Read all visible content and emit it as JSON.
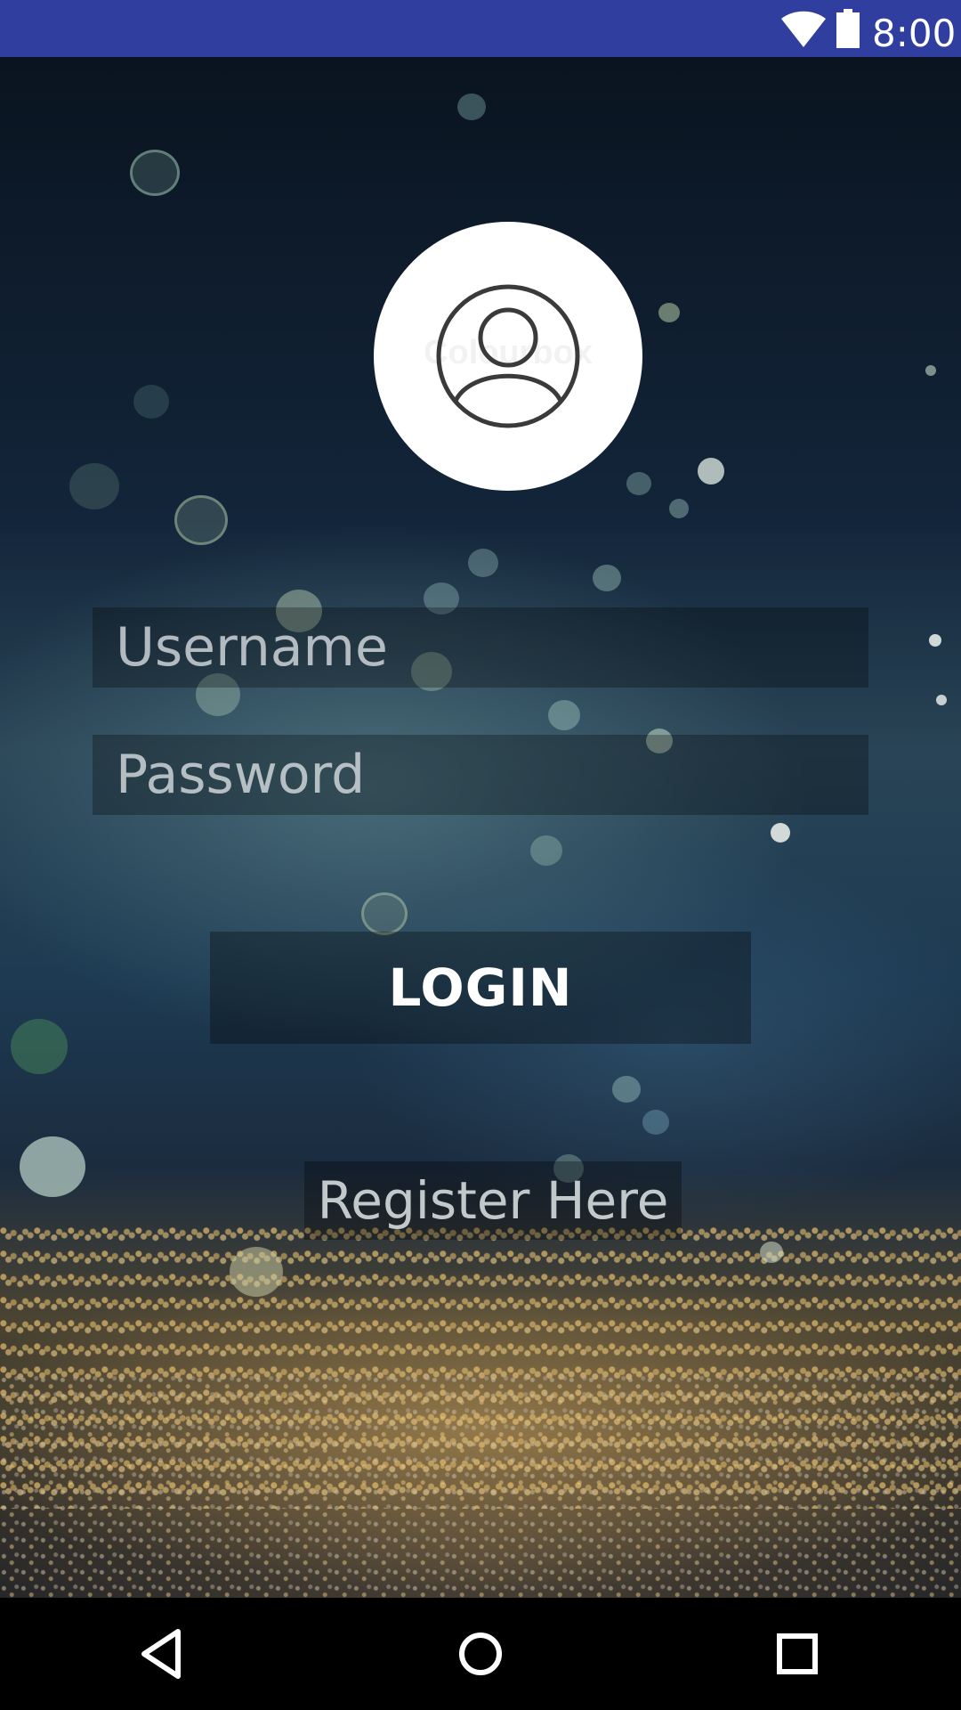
{
  "status_bar": {
    "time": "8:00",
    "background_color": "#303f9f",
    "icons": [
      "wifi-icon",
      "battery-icon"
    ]
  },
  "login_form": {
    "avatar_icon": "user-account-icon",
    "username_placeholder": "Username",
    "password_placeholder": "Password",
    "login_label": "LOGIN",
    "register_label": "Register Here"
  },
  "nav_bar": {
    "icons": [
      "back-icon",
      "home-icon",
      "recents-icon"
    ]
  }
}
